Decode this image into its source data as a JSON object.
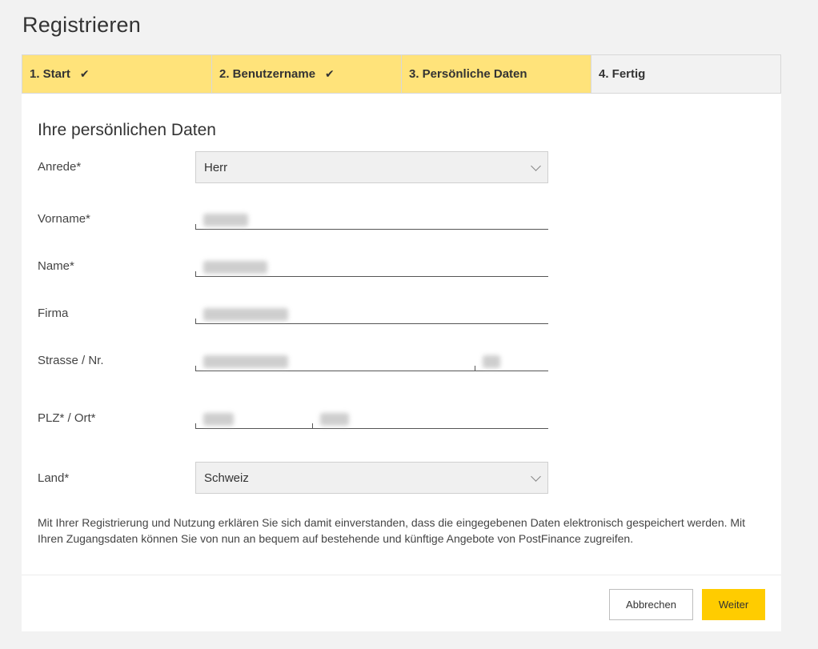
{
  "page": {
    "title": "Registrieren"
  },
  "steps": [
    {
      "label": "1. Start",
      "state": "done",
      "check": "✔"
    },
    {
      "label": "2. Benutzername",
      "state": "done",
      "check": "✔"
    },
    {
      "label": "3. Persönliche Daten",
      "state": "active",
      "check": ""
    },
    {
      "label": "4. Fertig",
      "state": "todo",
      "check": ""
    }
  ],
  "form": {
    "section_title": "Ihre persönlichen Daten",
    "anrede": {
      "label": "Anrede*",
      "value": "Herr"
    },
    "vorname": {
      "label": "Vorname*"
    },
    "name": {
      "label": "Name*"
    },
    "firma": {
      "label": "Firma"
    },
    "strasse": {
      "label": "Strasse / Nr."
    },
    "plz_ort": {
      "label": "PLZ* / Ort*"
    },
    "land": {
      "label": "Land*",
      "value": "Schweiz"
    }
  },
  "info_text": "Mit Ihrer Registrierung und Nutzung erklären Sie sich damit einverstanden, dass die eingegebenen Daten elektronisch gespeichert werden. Mit Ihren Zugangsdaten können Sie von nun an bequem auf bestehende und künftige Angebote von PostFinance zugreifen.",
  "buttons": {
    "cancel": "Abbrechen",
    "next": "Weiter"
  },
  "colors": {
    "step_active": "#ffe37a",
    "primary_button": "#ffcc00",
    "page_bg": "#f2f2f2"
  }
}
